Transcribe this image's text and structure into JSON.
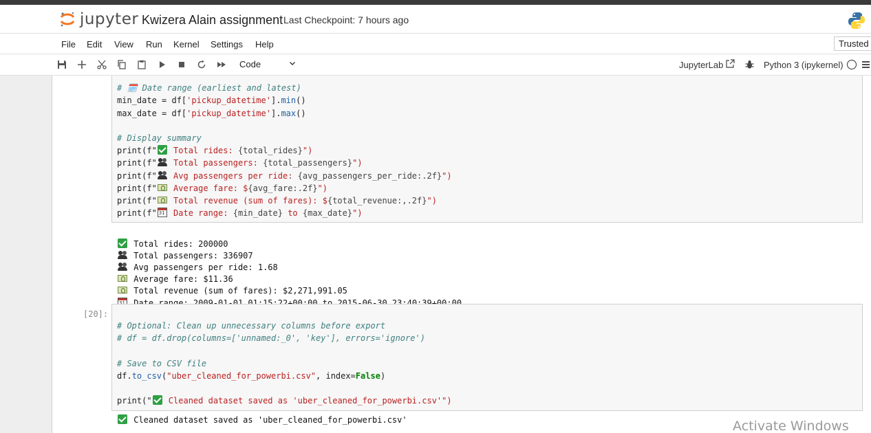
{
  "header": {
    "logo_text": "jupyter",
    "notebook_title": "Kwizera Alain assignment",
    "checkpoint": "Last Checkpoint: 7 hours ago"
  },
  "menu": {
    "items": [
      "File",
      "Edit",
      "View",
      "Run",
      "Kernel",
      "Settings",
      "Help"
    ],
    "trusted": "Trusted"
  },
  "toolbar": {
    "cell_type": "Code",
    "jupyterlab_link": "JupyterLab",
    "kernel_name": "Python 3 (ipykernel)"
  },
  "cells": {
    "cell1": {
      "prompt": "",
      "lines": {
        "l0": "# 🗓️ Date range (earliest and latest)",
        "l1a": "min_date = df[",
        "l1s": "'pickup_datetime'",
        "l1b": "].",
        "l1f": "min",
        "l1c": "()",
        "l2a": "max_date = df[",
        "l2s": "'pickup_datetime'",
        "l2b": "].",
        "l2f": "max",
        "l2c": "()",
        "l4": "# Display summary",
        "p_open": "print(f\"",
        "p1": " Total rides: ",
        "p1v": "{total_rides}",
        "p1e": "\")",
        "p2": " Total passengers: ",
        "p2v": "{total_passengers}",
        "p2e": "\")",
        "p3": " Avg passengers per ride: ",
        "p3v": "{avg_passengers_per_ride:.2f}",
        "p3e": "\")",
        "p4": " Average fare: $",
        "p4v": "{avg_fare:.2f}",
        "p4e": "\")",
        "p5": " Total revenue (sum of fares): $",
        "p5v": "{total_revenue:,.2f}",
        "p5e": "\")",
        "p6": " Date range: ",
        "p6v": "{min_date}",
        "p6m": " to ",
        "p6v2": "{max_date}",
        "p6e": "\")"
      },
      "output": [
        "Total rides: 200000",
        "Total passengers: 336907",
        "Avg passengers per ride: 1.68",
        "Average fare: $11.36",
        "Total revenue (sum of fares): $2,271,991.05",
        "Date range: 2009-01-01 01:15:22+00:00 to 2015-06-30 23:40:39+00:00"
      ]
    },
    "cell2": {
      "prompt": "[20]:",
      "lines": {
        "c1": "# Optional: Clean up unnecessary columns before export",
        "c2": "# df = df.drop(columns=['unnamed:_0', 'key'], errors='ignore')",
        "c3": "# Save to CSV file",
        "s1a": "df.",
        "s1f": "to_csv",
        "s1b": "(",
        "s1s": "\"uber_cleaned_for_powerbi.csv\"",
        "s1c": ", index=",
        "s1k": "False",
        "s1d": ")",
        "pr_open": "print(\"",
        "pr_text": " Cleaned dataset saved as 'uber_cleaned_for_powerbi.csv'",
        "pr_close": "\")"
      },
      "output": "Cleaned dataset saved as 'uber_cleaned_for_powerbi.csv'"
    }
  },
  "watermark": "Activate Windows"
}
